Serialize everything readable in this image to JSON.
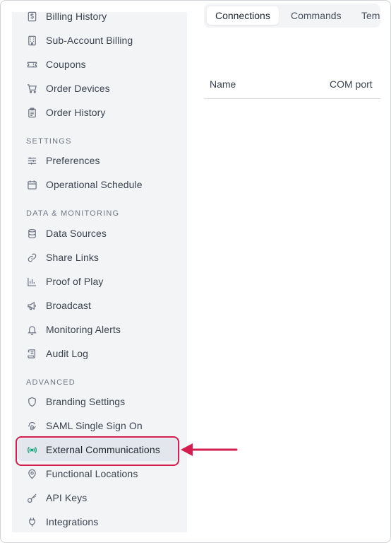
{
  "sidebar": {
    "billing_items": [
      {
        "label": "Billing History",
        "icon": "dollar-icon"
      },
      {
        "label": "Sub-Account Billing",
        "icon": "building-icon"
      },
      {
        "label": "Coupons",
        "icon": "ticket-icon"
      },
      {
        "label": "Order Devices",
        "icon": "cart-icon"
      },
      {
        "label": "Order History",
        "icon": "clipboard-icon"
      }
    ],
    "settings": {
      "title": "SETTINGS",
      "items": [
        {
          "label": "Preferences",
          "icon": "sliders-icon"
        },
        {
          "label": "Operational Schedule",
          "icon": "calendar-icon"
        }
      ]
    },
    "data_monitoring": {
      "title": "DATA & MONITORING",
      "items": [
        {
          "label": "Data Sources",
          "icon": "database-icon"
        },
        {
          "label": "Share Links",
          "icon": "link-icon"
        },
        {
          "label": "Proof of Play",
          "icon": "bar-chart-icon"
        },
        {
          "label": "Broadcast",
          "icon": "megaphone-icon"
        },
        {
          "label": "Monitoring Alerts",
          "icon": "bell-icon"
        },
        {
          "label": "Audit Log",
          "icon": "scroll-icon"
        }
      ]
    },
    "advanced": {
      "title": "ADVANCED",
      "items": [
        {
          "label": "Branding Settings",
          "icon": "shield-icon"
        },
        {
          "label": "SAML Single Sign On",
          "icon": "fingerprint-icon"
        },
        {
          "label": "External Communications",
          "icon": "broadcast-icon",
          "active": true
        },
        {
          "label": "Functional Locations",
          "icon": "map-pin-icon"
        },
        {
          "label": "API Keys",
          "icon": "key-icon"
        },
        {
          "label": "Integrations",
          "icon": "plug-icon"
        }
      ]
    }
  },
  "tabs": [
    {
      "label": "Connections",
      "active": true
    },
    {
      "label": "Commands"
    },
    {
      "label": "Tem"
    }
  ],
  "table": {
    "columns": [
      "Name",
      "COM port"
    ]
  },
  "colors": {
    "highlight": "#d31e4f",
    "active_icon": "#16a37f",
    "sidebar_bg": "#f3f4f6"
  }
}
